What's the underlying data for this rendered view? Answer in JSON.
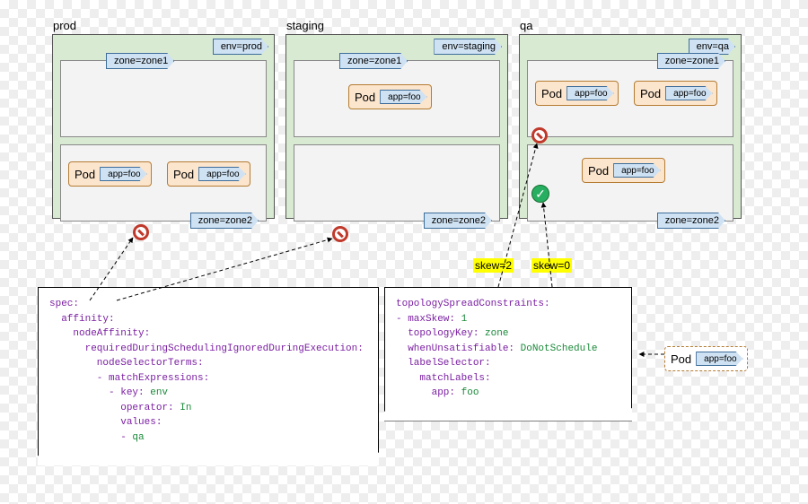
{
  "clusters": [
    {
      "name": "prod",
      "env_tag": "env=prod",
      "zones": [
        "zone=zone1",
        "zone=zone2"
      ],
      "pods": [
        {
          "zone": 1,
          "slot": 0,
          "label": "Pod",
          "app": "app=foo"
        },
        {
          "zone": 1,
          "slot": 1,
          "label": "Pod",
          "app": "app=foo"
        }
      ]
    },
    {
      "name": "staging",
      "env_tag": "env=staging",
      "zones": [
        "zone=zone1",
        "zone=zone2"
      ],
      "pods": [
        {
          "zone": 0,
          "slot": 0,
          "label": "Pod",
          "app": "app=foo"
        }
      ]
    },
    {
      "name": "qa",
      "env_tag": "env=qa",
      "zones": [
        "zone=zone1",
        "zone=zone2"
      ],
      "pods": [
        {
          "zone": 0,
          "slot": 0,
          "label": "Pod",
          "app": "app=foo"
        },
        {
          "zone": 0,
          "slot": 1,
          "label": "Pod",
          "app": "app=foo"
        },
        {
          "zone": 1,
          "slot": 0,
          "label": "Pod",
          "app": "app=foo"
        }
      ]
    }
  ],
  "skew_labels": {
    "a": "skew=2",
    "b": "skew=0"
  },
  "floating_pod": {
    "label": "Pod",
    "app": "app=foo"
  },
  "yaml_left": {
    "l0": "spec:",
    "l1": "  affinity:",
    "l2": "    nodeAffinity:",
    "l3": "      requiredDuringSchedulingIgnoredDuringExecution:",
    "l4": "        nodeSelectorTerms:",
    "l5": "        - matchExpressions:",
    "l6": "          - key:",
    "v6": " env",
    "l7": "            operator:",
    "v7": " In",
    "l8": "            values:",
    "l9": "            - ",
    "v9": "qa"
  },
  "yaml_right": {
    "l0": "topologySpreadConstraints:",
    "l1": "- maxSkew:",
    "v1": " 1",
    "l2": "  topologyKey:",
    "v2": " zone",
    "l3": "  whenUnsatisfiable:",
    "v3": " DoNotSchedule",
    "l4": "  labelSelector:",
    "l5": "    matchLabels:",
    "l6": "      app:",
    "v6": " foo"
  }
}
